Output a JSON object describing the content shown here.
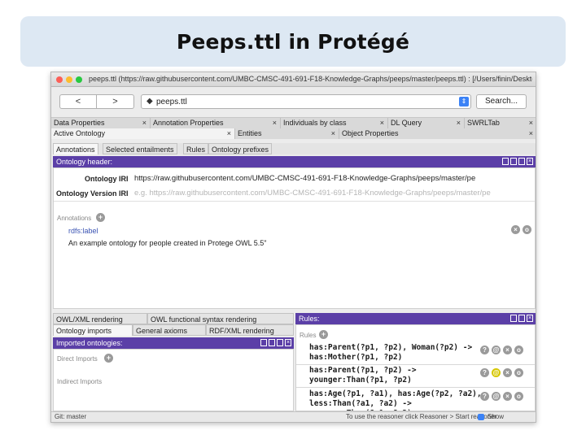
{
  "slide": {
    "title": "Peeps.ttl in Protégé"
  },
  "window": {
    "title": "peeps.ttl (https://raw.githubusercontent.com/UMBC-CMSC-491-691-F18-Knowledge-Graphs/peeps/master/peeps.ttl) : [/Users/finin/Deskto...",
    "back_label": "<",
    "forward_label": ">",
    "address": "peeps.ttl",
    "search_label": "Search..."
  },
  "tabs_row1": [
    "Data Properties",
    "Annotation Properties",
    "Individuals by class",
    "DL Query",
    "SWRLTab"
  ],
  "tabs_row2": [
    "Active Ontology",
    "Entities",
    "Object Properties"
  ],
  "close_glyph": "×",
  "ontology_tabs": [
    "Annotations",
    "Selected entailments",
    "Rules",
    "Ontology prefixes"
  ],
  "ontology_header": {
    "title": "Ontology header:",
    "iri_label": "Ontology IRI",
    "iri_value": "https://raw.githubusercontent.com/UMBC-CMSC-491-691-F18-Knowledge-Graphs/peeps/master/pe",
    "version_label": "Ontology Version IRI",
    "version_placeholder": "e.g. https://raw.githubusercontent.com/UMBC-CMSC-491-691-F18-Knowledge-Graphs/peeps/master/pe",
    "annotations_label": "Annotations",
    "annotation_property": "rdfs:label",
    "annotation_value": "An example ontology for people created in Protege OWL 5.5\""
  },
  "bottom_left": {
    "tabs_row_a": [
      "OWL/XML rendering",
      "OWL functional syntax rendering"
    ],
    "tabs_row_b": [
      "Ontology imports",
      "General axioms",
      "RDF/XML rendering"
    ],
    "header": "Imported ontologies:",
    "direct_imports": "Direct Imports",
    "indirect_imports": "Indirect Imports"
  },
  "rules_panel": {
    "header": "Rules:",
    "label": "Rules",
    "rules": [
      "has:Parent(?p1, ?p2), Woman(?p2) ->\nhas:Mother(?p1, ?p2)",
      "has:Parent(?p1, ?p2) ->\nyounger:Than(?p1, ?p2)",
      "has:Age(?p1, ?a1), has:Age(?p2, ?a2),\nless:Than(?a1, ?a2) ->\nyounger:Than(?p1, ?p2)"
    ]
  },
  "status": {
    "left": "Git: master",
    "middle": "To use the reasoner click Reasoner > Start reasoner",
    "right": "Show Inferences"
  },
  "colors": {
    "purple_header": "#5b3fa7",
    "title_box": "#dde8f3"
  }
}
